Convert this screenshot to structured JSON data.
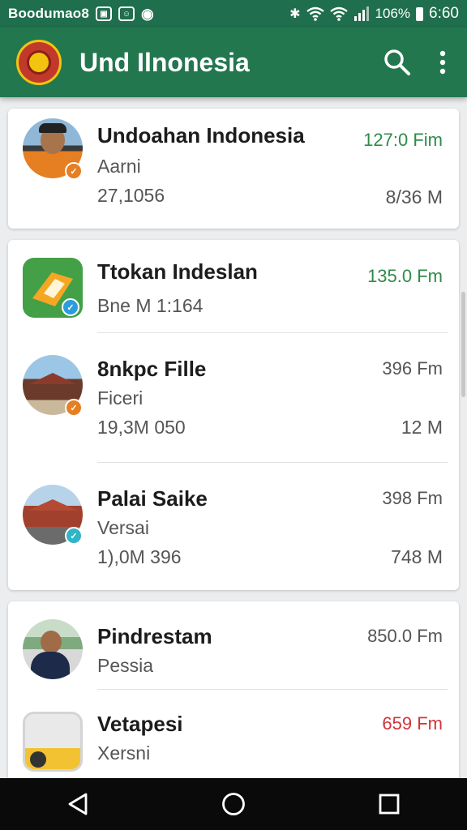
{
  "status_bar": {
    "carrier": "Boodumao8",
    "battery": "106%",
    "time": "6:60"
  },
  "app_bar": {
    "title": "Und Ilnonesia",
    "icons": [
      "search-icon",
      "more-vert-icon"
    ]
  },
  "colors": {
    "primary": "#23774f",
    "status_bar": "#1f6e4e",
    "time_green": "#2e8b4a",
    "time_red": "#d0343a"
  },
  "cards": [
    {
      "items": [
        {
          "name": "Undoahan Indonesia",
          "sub": "Aarni",
          "meta": "27,1056",
          "time": "127:0 Fim",
          "size": "8/36 M",
          "time_color": "green",
          "badge": "orange"
        }
      ]
    },
    {
      "items": [
        {
          "name": "Ttokan Indeslan",
          "sub": "Bne M 1:164",
          "meta": "",
          "time": "135.0 Fm",
          "size": "",
          "time_color": "green",
          "badge": "blue"
        },
        {
          "name": "8nkpc Fille",
          "sub": "Ficeri",
          "meta": "19,3M 050",
          "time": "396 Fm",
          "size": "12 M",
          "time_color": "gray",
          "badge": "orange"
        },
        {
          "name": "Palai Saike",
          "sub": "Versai",
          "meta": "1),0M 396",
          "time": "398 Fm",
          "size": "748 M",
          "time_color": "gray",
          "badge": "teal"
        }
      ]
    },
    {
      "items": [
        {
          "name": "Pindrestam",
          "sub": "Pessia",
          "meta": "",
          "time": "850.0 Fm",
          "size": "",
          "time_color": "gray",
          "badge": "none"
        },
        {
          "name": "Vetapesi",
          "sub": "Xersni",
          "meta": "",
          "time": "659 Fm",
          "size": "",
          "time_color": "red",
          "badge": "none"
        }
      ]
    }
  ],
  "nav_bar": {
    "icons": [
      "back-icon",
      "home-icon",
      "recents-icon"
    ]
  }
}
